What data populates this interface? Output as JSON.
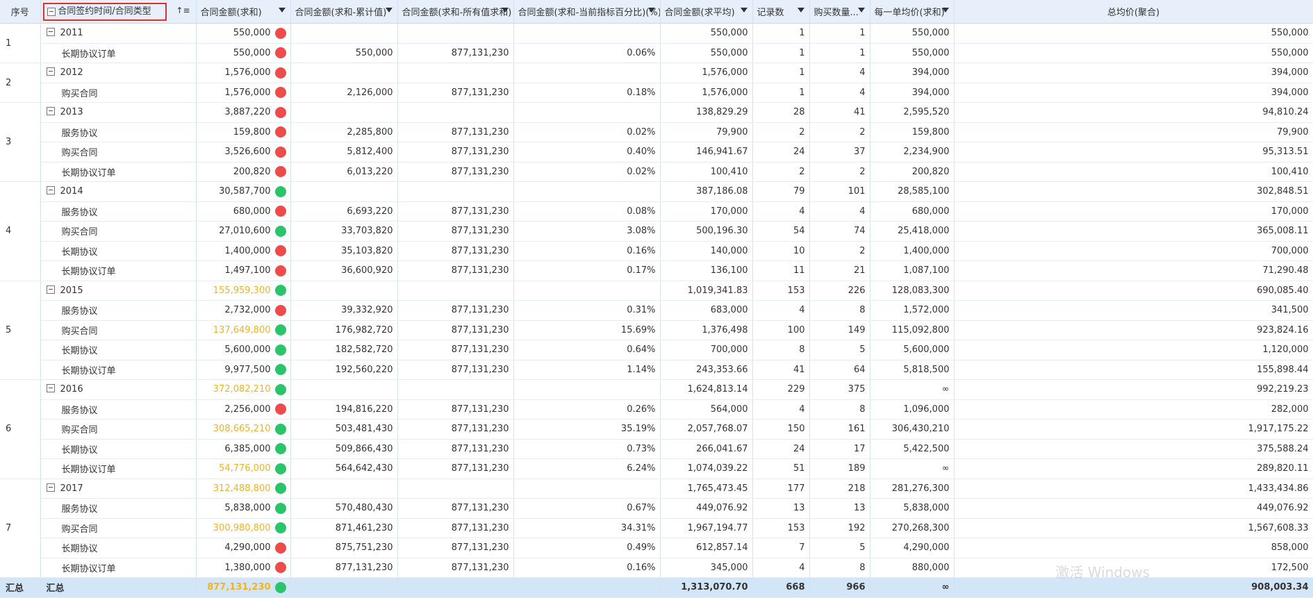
{
  "headers": {
    "seq": "序号",
    "dimension": "合同签约时间/合同类型",
    "amount_sum": "合同金额(求和)",
    "amount_cum": "合同金额(求和-累计值)",
    "amount_all": "合同金额(求和-所有值求和)",
    "amount_pct": "合同金额(求和-当前指标百分比)(%)",
    "amount_avg": "合同金额(求平均)",
    "record_count": "记录数",
    "qty": "购买数量...",
    "unit_price": "每一单均价(求和)",
    "total_avg": "总均价(聚合)"
  },
  "icons": {
    "expand": "collapse-minus-icon",
    "sort": "sort-icon",
    "dropdown": "dropdown-arrow-icon"
  },
  "colors": {
    "red_indicator": "#ef4b4b",
    "green_indicator": "#2ac46a",
    "highlight_text": "#f5b21f",
    "header_bg": "#e7f0fa",
    "total_bg": "#d3e6f8",
    "selection_border": "#e0302a"
  },
  "groups": [
    {
      "seq": "1",
      "year": "2011",
      "amount": "550,000",
      "dot": "red",
      "orange": false,
      "cum": "",
      "all": "",
      "pct": "",
      "avg": "550,000",
      "count": "1",
      "qty": "1",
      "unit": "550,000",
      "total": "550,000",
      "children": [
        {
          "label": "长期协议订单",
          "amount": "550,000",
          "dot": "red",
          "orange": false,
          "cum": "550,000",
          "all": "877,131,230",
          "pct": "0.06%",
          "avg": "550,000",
          "count": "1",
          "qty": "1",
          "unit": "550,000",
          "total": "550,000"
        }
      ]
    },
    {
      "seq": "2",
      "year": "2012",
      "amount": "1,576,000",
      "dot": "red",
      "orange": false,
      "cum": "",
      "all": "",
      "pct": "",
      "avg": "1,576,000",
      "count": "1",
      "qty": "4",
      "unit": "394,000",
      "total": "394,000",
      "children": [
        {
          "label": "购买合同",
          "amount": "1,576,000",
          "dot": "red",
          "orange": false,
          "cum": "2,126,000",
          "all": "877,131,230",
          "pct": "0.18%",
          "avg": "1,576,000",
          "count": "1",
          "qty": "4",
          "unit": "394,000",
          "total": "394,000"
        }
      ]
    },
    {
      "seq": "3",
      "year": "2013",
      "amount": "3,887,220",
      "dot": "red",
      "orange": false,
      "cum": "",
      "all": "",
      "pct": "",
      "avg": "138,829.29",
      "count": "28",
      "qty": "41",
      "unit": "2,595,520",
      "total": "94,810.24",
      "children": [
        {
          "label": "服务协议",
          "amount": "159,800",
          "dot": "red",
          "orange": false,
          "cum": "2,285,800",
          "all": "877,131,230",
          "pct": "0.02%",
          "avg": "79,900",
          "count": "2",
          "qty": "2",
          "unit": "159,800",
          "total": "79,900"
        },
        {
          "label": "购买合同",
          "amount": "3,526,600",
          "dot": "red",
          "orange": false,
          "cum": "5,812,400",
          "all": "877,131,230",
          "pct": "0.40%",
          "avg": "146,941.67",
          "count": "24",
          "qty": "37",
          "unit": "2,234,900",
          "total": "95,313.51"
        },
        {
          "label": "长期协议订单",
          "amount": "200,820",
          "dot": "red",
          "orange": false,
          "cum": "6,013,220",
          "all": "877,131,230",
          "pct": "0.02%",
          "avg": "100,410",
          "count": "2",
          "qty": "2",
          "unit": "200,820",
          "total": "100,410"
        }
      ]
    },
    {
      "seq": "4",
      "year": "2014",
      "amount": "30,587,700",
      "dot": "green",
      "orange": false,
      "cum": "",
      "all": "",
      "pct": "",
      "avg": "387,186.08",
      "count": "79",
      "qty": "101",
      "unit": "28,585,100",
      "total": "302,848.51",
      "children": [
        {
          "label": "服务协议",
          "amount": "680,000",
          "dot": "red",
          "orange": false,
          "cum": "6,693,220",
          "all": "877,131,230",
          "pct": "0.08%",
          "avg": "170,000",
          "count": "4",
          "qty": "4",
          "unit": "680,000",
          "total": "170,000"
        },
        {
          "label": "购买合同",
          "amount": "27,010,600",
          "dot": "green",
          "orange": false,
          "cum": "33,703,820",
          "all": "877,131,230",
          "pct": "3.08%",
          "avg": "500,196.30",
          "count": "54",
          "qty": "74",
          "unit": "25,418,000",
          "total": "365,008.11"
        },
        {
          "label": "长期协议",
          "amount": "1,400,000",
          "dot": "red",
          "orange": false,
          "cum": "35,103,820",
          "all": "877,131,230",
          "pct": "0.16%",
          "avg": "140,000",
          "count": "10",
          "qty": "2",
          "unit": "1,400,000",
          "total": "700,000"
        },
        {
          "label": "长期协议订单",
          "amount": "1,497,100",
          "dot": "red",
          "orange": false,
          "cum": "36,600,920",
          "all": "877,131,230",
          "pct": "0.17%",
          "avg": "136,100",
          "count": "11",
          "qty": "21",
          "unit": "1,087,100",
          "total": "71,290.48"
        }
      ]
    },
    {
      "seq": "5",
      "year": "2015",
      "amount": "155,959,300",
      "dot": "green",
      "orange": true,
      "cum": "",
      "all": "",
      "pct": "",
      "avg": "1,019,341.83",
      "count": "153",
      "qty": "226",
      "unit": "128,083,300",
      "total": "690,085.40",
      "children": [
        {
          "label": "服务协议",
          "amount": "2,732,000",
          "dot": "red",
          "orange": false,
          "cum": "39,332,920",
          "all": "877,131,230",
          "pct": "0.31%",
          "avg": "683,000",
          "count": "4",
          "qty": "8",
          "unit": "1,572,000",
          "total": "341,500"
        },
        {
          "label": "购买合同",
          "amount": "137,649,800",
          "dot": "green",
          "orange": true,
          "cum": "176,982,720",
          "all": "877,131,230",
          "pct": "15.69%",
          "avg": "1,376,498",
          "count": "100",
          "qty": "149",
          "unit": "115,092,800",
          "total": "923,824.16"
        },
        {
          "label": "长期协议",
          "amount": "5,600,000",
          "dot": "green",
          "orange": false,
          "cum": "182,582,720",
          "all": "877,131,230",
          "pct": "0.64%",
          "avg": "700,000",
          "count": "8",
          "qty": "5",
          "unit": "5,600,000",
          "total": "1,120,000"
        },
        {
          "label": "长期协议订单",
          "amount": "9,977,500",
          "dot": "green",
          "orange": false,
          "cum": "192,560,220",
          "all": "877,131,230",
          "pct": "1.14%",
          "avg": "243,353.66",
          "count": "41",
          "qty": "64",
          "unit": "5,818,500",
          "total": "155,898.44"
        }
      ]
    },
    {
      "seq": "6",
      "year": "2016",
      "amount": "372,082,210",
      "dot": "green",
      "orange": true,
      "cum": "",
      "all": "",
      "pct": "",
      "avg": "1,624,813.14",
      "count": "229",
      "qty": "375",
      "unit": "∞",
      "total": "992,219.23",
      "children": [
        {
          "label": "服务协议",
          "amount": "2,256,000",
          "dot": "red",
          "orange": false,
          "cum": "194,816,220",
          "all": "877,131,230",
          "pct": "0.26%",
          "avg": "564,000",
          "count": "4",
          "qty": "8",
          "unit": "1,096,000",
          "total": "282,000"
        },
        {
          "label": "购买合同",
          "amount": "308,665,210",
          "dot": "green",
          "orange": true,
          "cum": "503,481,430",
          "all": "877,131,230",
          "pct": "35.19%",
          "avg": "2,057,768.07",
          "count": "150",
          "qty": "161",
          "unit": "306,430,210",
          "total": "1,917,175.22"
        },
        {
          "label": "长期协议",
          "amount": "6,385,000",
          "dot": "green",
          "orange": false,
          "cum": "509,866,430",
          "all": "877,131,230",
          "pct": "0.73%",
          "avg": "266,041.67",
          "count": "24",
          "qty": "17",
          "unit": "5,422,500",
          "total": "375,588.24"
        },
        {
          "label": "长期协议订单",
          "amount": "54,776,000",
          "dot": "green",
          "orange": true,
          "cum": "564,642,430",
          "all": "877,131,230",
          "pct": "6.24%",
          "avg": "1,074,039.22",
          "count": "51",
          "qty": "189",
          "unit": "∞",
          "total": "289,820.11"
        }
      ]
    },
    {
      "seq": "7",
      "year": "2017",
      "amount": "312,488,800",
      "dot": "green",
      "orange": true,
      "cum": "",
      "all": "",
      "pct": "",
      "avg": "1,765,473.45",
      "count": "177",
      "qty": "218",
      "unit": "281,276,300",
      "total": "1,433,434.86",
      "children": [
        {
          "label": "服务协议",
          "amount": "5,838,000",
          "dot": "green",
          "orange": false,
          "cum": "570,480,430",
          "all": "877,131,230",
          "pct": "0.67%",
          "avg": "449,076.92",
          "count": "13",
          "qty": "13",
          "unit": "5,838,000",
          "total": "449,076.92"
        },
        {
          "label": "购买合同",
          "amount": "300,980,800",
          "dot": "green",
          "orange": true,
          "cum": "871,461,230",
          "all": "877,131,230",
          "pct": "34.31%",
          "avg": "1,967,194.77",
          "count": "153",
          "qty": "192",
          "unit": "270,268,300",
          "total": "1,567,608.33"
        },
        {
          "label": "长期协议",
          "amount": "4,290,000",
          "dot": "red",
          "orange": false,
          "cum": "875,751,230",
          "all": "877,131,230",
          "pct": "0.49%",
          "avg": "612,857.14",
          "count": "7",
          "qty": "5",
          "unit": "4,290,000",
          "total": "858,000"
        },
        {
          "label": "长期协议订单",
          "amount": "1,380,000",
          "dot": "red",
          "orange": false,
          "cum": "877,131,230",
          "all": "877,131,230",
          "pct": "0.16%",
          "avg": "345,000",
          "count": "4",
          "qty": "8",
          "unit": "880,000",
          "total": "172,500"
        }
      ]
    }
  ],
  "total": {
    "seq": "汇总",
    "label": "汇总",
    "amount": "877,131,230",
    "dot": "green",
    "orange": true,
    "cum": "",
    "all": "",
    "pct": "",
    "avg": "1,313,070.70",
    "count": "668",
    "qty": "966",
    "unit": "∞",
    "total": "908,003.34"
  },
  "watermark": "激活 Windows"
}
